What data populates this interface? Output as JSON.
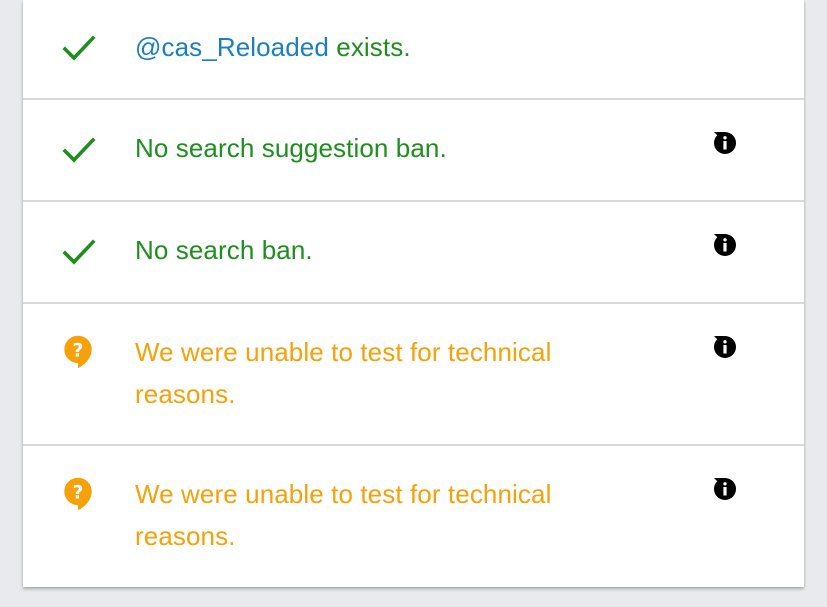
{
  "results": {
    "exists": {
      "handle": "@cas_Reloaded",
      "suffix": " exists."
    },
    "suggestion_ban": {
      "text": "No search suggestion ban."
    },
    "search_ban": {
      "text": "No search ban."
    },
    "test_1": {
      "text": "We were unable to test for technical reasons."
    },
    "test_2": {
      "text": "We were unable to test for technical reasons."
    }
  },
  "colors": {
    "success": "#1e8e1e",
    "warning": "#f6a00a",
    "link": "#1a7fc0"
  },
  "icons": {
    "success": "check-icon",
    "warning": "question-bubble-icon",
    "info": "info-icon",
    "dropdown": "caret-down-icon"
  }
}
